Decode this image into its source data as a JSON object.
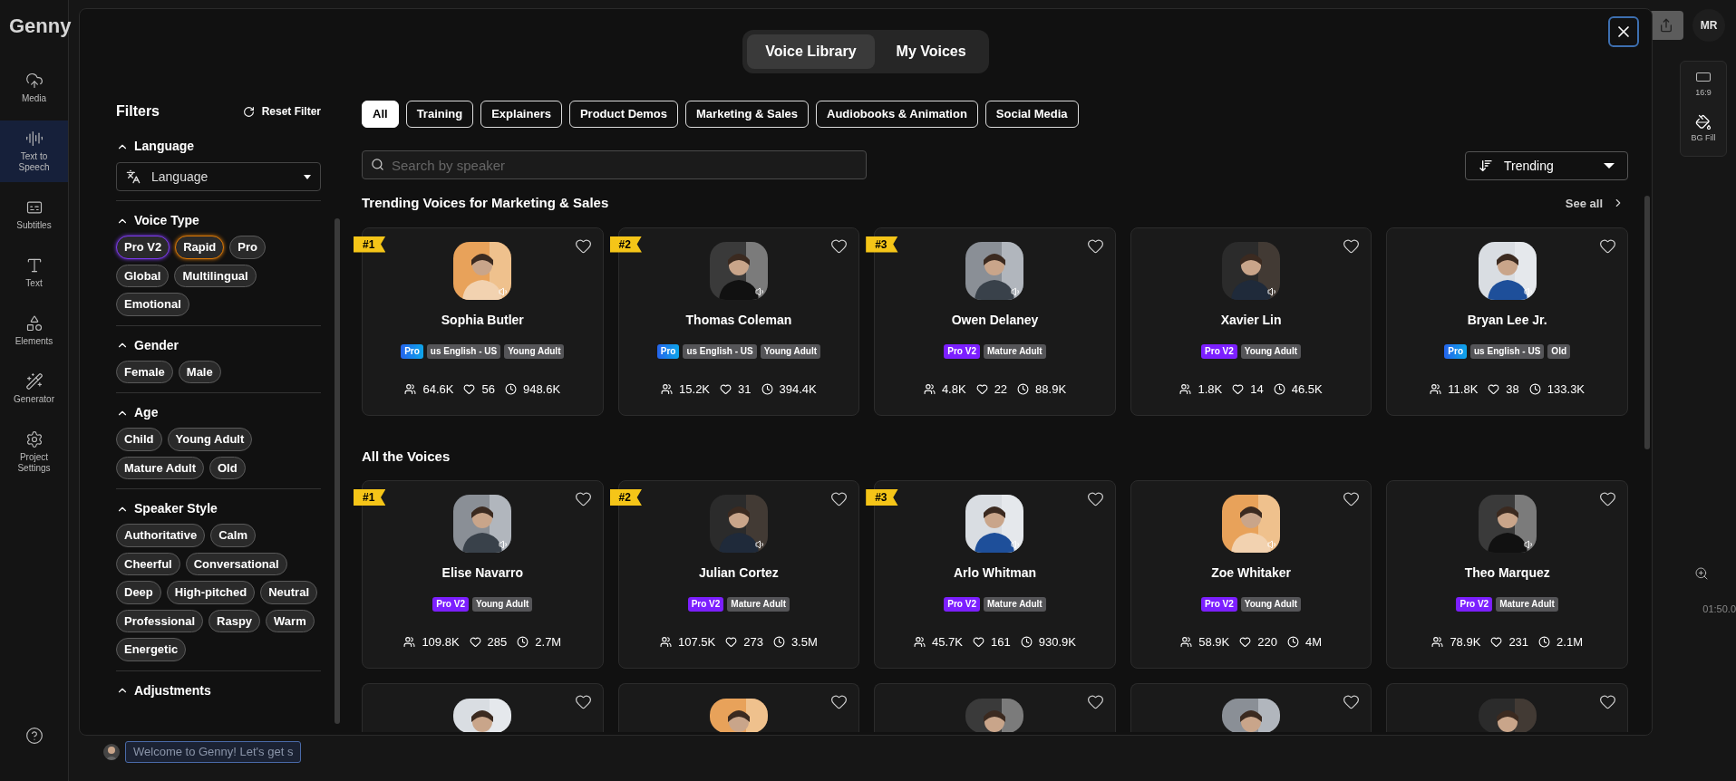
{
  "app": {
    "logo": "Genny",
    "nav": [
      {
        "label": "Media",
        "selected": false
      },
      {
        "label": "Text to Speech",
        "selected": true
      },
      {
        "label": "Subtitles",
        "selected": false
      },
      {
        "label": "Text",
        "selected": false
      },
      {
        "label": "Elements",
        "selected": false
      },
      {
        "label": "Generator",
        "selected": false
      },
      {
        "label": "Project Settings",
        "selected": false
      }
    ],
    "account": "MR",
    "side_tools": [
      "16:9",
      "BG Fill"
    ],
    "timeline_time": "01:50.0",
    "caption": "Welcome to Genny! Let's get s"
  },
  "modal": {
    "tabs": [
      {
        "label": "Voice Library",
        "selected": true
      },
      {
        "label": "My Voices",
        "selected": false
      }
    ],
    "filters": {
      "title": "Filters",
      "reset": "Reset Filter",
      "language": {
        "title": "Language",
        "expanded": true,
        "placeholder": "Language"
      },
      "groups": [
        {
          "title": "Voice Type",
          "expanded": true,
          "chips": [
            {
              "label": "Pro V2",
              "color": "#7c3aed"
            },
            {
              "label": "Rapid",
              "color": "#d97706"
            },
            {
              "label": "Pro"
            },
            {
              "label": "Global"
            },
            {
              "label": "Multilingual"
            },
            {
              "label": "Emotional"
            }
          ]
        },
        {
          "title": "Gender",
          "expanded": true,
          "chips": [
            {
              "label": "Female"
            },
            {
              "label": "Male"
            }
          ]
        },
        {
          "title": "Age",
          "expanded": true,
          "chips": [
            {
              "label": "Child"
            },
            {
              "label": "Young Adult"
            },
            {
              "label": "Mature Adult"
            },
            {
              "label": "Old"
            }
          ]
        },
        {
          "title": "Speaker Style",
          "expanded": true,
          "chips": [
            {
              "label": "Authoritative"
            },
            {
              "label": "Calm"
            },
            {
              "label": "Cheerful"
            },
            {
              "label": "Conversational"
            },
            {
              "label": "Deep"
            },
            {
              "label": "High-pitched"
            },
            {
              "label": "Neutral"
            },
            {
              "label": "Professional"
            },
            {
              "label": "Raspy"
            },
            {
              "label": "Warm"
            },
            {
              "label": "Energetic"
            }
          ]
        },
        {
          "title": "Adjustments",
          "expanded": true
        }
      ]
    },
    "categories": [
      {
        "label": "All",
        "selected": true
      },
      {
        "label": "Training",
        "selected": false
      },
      {
        "label": "Explainers",
        "selected": false
      },
      {
        "label": "Product Demos",
        "selected": false
      },
      {
        "label": "Marketing & Sales",
        "selected": false
      },
      {
        "label": "Audiobooks & Animation",
        "selected": false
      },
      {
        "label": "Social Media",
        "selected": false
      }
    ],
    "search": {
      "placeholder": "Search by speaker"
    },
    "sort": "Trending",
    "sections": [
      {
        "title": "Trending Voices for Marketing & Sales",
        "see_all": "See all",
        "voices": [
          {
            "rank": "#1",
            "name": "Sophia Butler",
            "favorite": false,
            "tags": [
              {
                "kind": "pro",
                "label": "Pro"
              },
              {
                "kind": "plain",
                "label": "us English - US"
              },
              {
                "kind": "plain",
                "label": "Young Adult"
              }
            ],
            "listeners": "64.6K",
            "likes": "56",
            "plays": "948.6K"
          },
          {
            "rank": "#2",
            "name": "Thomas Coleman",
            "favorite": false,
            "tags": [
              {
                "kind": "pro",
                "label": "Pro"
              },
              {
                "kind": "plain",
                "label": "us English - US"
              },
              {
                "kind": "plain",
                "label": "Young Adult"
              }
            ],
            "listeners": "15.2K",
            "likes": "31",
            "plays": "394.4K"
          },
          {
            "rank": "#3",
            "name": "Owen Delaney",
            "favorite": false,
            "tags": [
              {
                "kind": "pro_v2",
                "label": "Pro V2"
              },
              {
                "kind": "plain",
                "label": "Mature Adult"
              }
            ],
            "listeners": "4.8K",
            "likes": "22",
            "plays": "88.9K"
          },
          {
            "name": "Xavier Lin",
            "favorite": false,
            "tags": [
              {
                "kind": "pro_v2",
                "label": "Pro V2"
              },
              {
                "kind": "plain",
                "label": "Young Adult"
              }
            ],
            "listeners": "1.8K",
            "likes": "14",
            "plays": "46.5K"
          },
          {
            "name": "Bryan Lee Jr.",
            "favorite": false,
            "tags": [
              {
                "kind": "pro",
                "label": "Pro"
              },
              {
                "kind": "plain",
                "label": "us English - US"
              },
              {
                "kind": "plain",
                "label": "Old"
              }
            ],
            "listeners": "11.8K",
            "likes": "38",
            "plays": "133.3K"
          }
        ]
      },
      {
        "title": "All the Voices",
        "voices": [
          {
            "rank": "#1",
            "name": "Elise Navarro",
            "favorite": false,
            "tags": [
              {
                "kind": "pro_v2",
                "label": "Pro V2"
              },
              {
                "kind": "plain",
                "label": "Young Adult"
              }
            ],
            "listeners": "109.8K",
            "likes": "285",
            "plays": "2.7M"
          },
          {
            "rank": "#2",
            "name": "Julian Cortez",
            "favorite": false,
            "tags": [
              {
                "kind": "pro_v2",
                "label": "Pro V2"
              },
              {
                "kind": "plain",
                "label": "Mature Adult"
              }
            ],
            "listeners": "107.5K",
            "likes": "273",
            "plays": "3.5M"
          },
          {
            "rank": "#3",
            "name": "Arlo Whitman",
            "favorite": false,
            "tags": [
              {
                "kind": "pro_v2",
                "label": "Pro V2"
              },
              {
                "kind": "plain",
                "label": "Mature Adult"
              }
            ],
            "listeners": "45.7K",
            "likes": "161",
            "plays": "930.9K"
          },
          {
            "name": "Zoe Whitaker",
            "favorite": false,
            "tags": [
              {
                "kind": "pro_v2",
                "label": "Pro V2"
              },
              {
                "kind": "plain",
                "label": "Young Adult"
              }
            ],
            "listeners": "58.9K",
            "likes": "220",
            "plays": "4M"
          },
          {
            "name": "Theo Marquez",
            "favorite": false,
            "tags": [
              {
                "kind": "pro_v2",
                "label": "Pro V2"
              },
              {
                "kind": "plain",
                "label": "Mature Adult"
              }
            ],
            "listeners": "78.9K",
            "likes": "231",
            "plays": "2.1M"
          },
          {
            "kind": "partial",
            "favorite": false
          },
          {
            "kind": "partial",
            "favorite": false
          },
          {
            "kind": "partial",
            "favorite": false
          },
          {
            "kind": "partial",
            "favorite": false
          },
          {
            "kind": "partial",
            "favorite": false
          }
        ]
      }
    ]
  }
}
